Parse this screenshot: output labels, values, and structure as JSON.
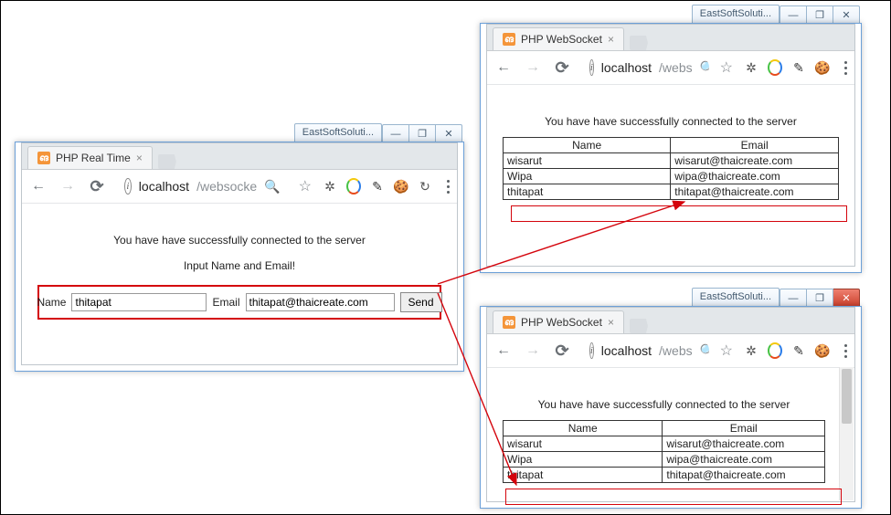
{
  "taskbar_app": "EastSoftSoluti...",
  "window_controls": {
    "min": "—",
    "max": "❐",
    "close_glyph": "✕"
  },
  "browser": {
    "nav": {
      "back": "←",
      "forward": "→",
      "reload": "↻"
    },
    "url_host": "localhost",
    "star": "☆",
    "menu_label": "menu",
    "ext_icons": [
      "spider",
      "ring",
      "pencil",
      "cookie",
      "refresh"
    ]
  },
  "winA": {
    "tab_title": "PHP Real Time",
    "url_path": "/websocke",
    "msg_connected": "You have have successfully connected to the server",
    "msg_prompt": "Input Name and Email!",
    "label_name": "Name",
    "label_email": "Email",
    "input_name": "thitapat",
    "input_email": "thitapat@thaicreate.com",
    "btn_send": "Send"
  },
  "winB": {
    "tab_title": "PHP WebSocket",
    "url_path": "/webs",
    "msg_connected": "You have have successfully connected to the server",
    "table": {
      "headers": [
        "Name",
        "Email"
      ],
      "rows": [
        [
          "wisarut",
          "wisarut@thaicreate.com"
        ],
        [
          "Wipa",
          "wipa@thaicreate.com"
        ],
        [
          "thitapat",
          "thitapat@thaicreate.com"
        ]
      ]
    }
  },
  "winC": {
    "tab_title": "PHP WebSocket",
    "url_path": "/webs",
    "msg_connected": "You have have successfully connected to the server",
    "table": {
      "headers": [
        "Name",
        "Email"
      ],
      "rows": [
        [
          "wisarut",
          "wisarut@thaicreate.com"
        ],
        [
          "Wipa",
          "wipa@thaicreate.com"
        ],
        [
          "thitapat",
          "thitapat@thaicreate.com"
        ]
      ]
    }
  },
  "colors": {
    "annot_red": "#d4040c"
  }
}
